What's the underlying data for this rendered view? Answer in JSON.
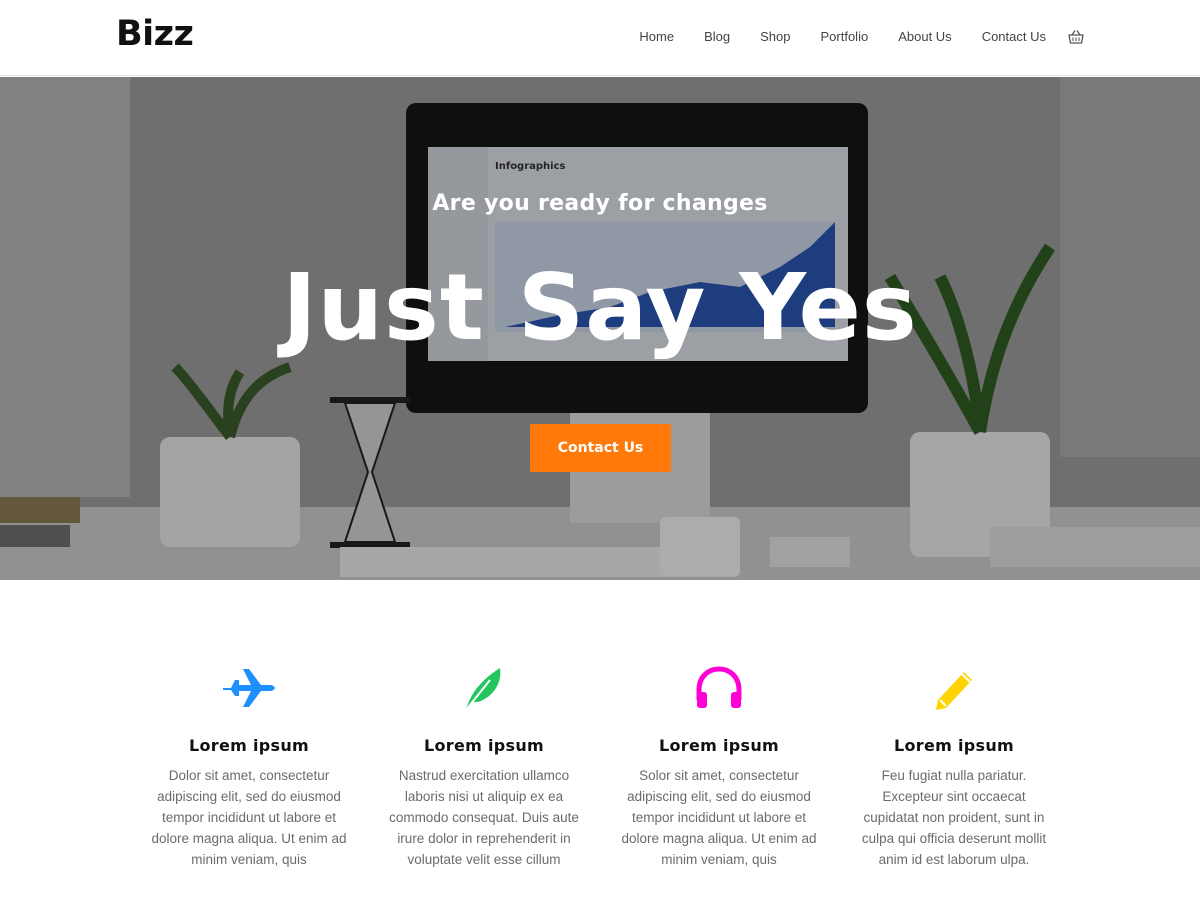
{
  "header": {
    "logo": "Bizz",
    "nav": [
      "Home",
      "Blog",
      "Shop",
      "Portfolio",
      "About Us",
      "Contact Us"
    ],
    "cart_icon": "shopping-basket-icon"
  },
  "hero": {
    "subtitle": "Are you ready for changes",
    "title": "Just Say Yes",
    "button_label": "Contact Us",
    "button_color": "#ff7a0a",
    "monitor_screen_title": "Infographics"
  },
  "features": [
    {
      "icon": "jet-plane-icon",
      "color": "#1e90ff",
      "title": "Lorem ipsum",
      "text": [
        "Dolor sit amet, consectetur",
        "adipiscing elit, sed do eiusmod",
        "tempor incididunt ut labore et",
        "dolore magna aliqua. Ut enim ad",
        "minim veniam, quis"
      ]
    },
    {
      "icon": "feather-icon",
      "color": "#22c55e",
      "title": "Lorem ipsum",
      "text": [
        "Nastrud exercitation ullamco",
        "laboris nisi ut aliquip ex ea",
        "commodo consequat. Duis aute",
        "irure dolor in reprehenderit in",
        "voluptate velit esse cillum"
      ]
    },
    {
      "icon": "headphones-icon",
      "color": "#ff00d4",
      "title": "Lorem ipsum",
      "text": [
        "Solor sit amet, consectetur",
        "adipiscing elit, sed do eiusmod",
        "tempor incididunt ut labore et",
        "dolore magna aliqua. Ut enim ad",
        "minim veniam, quis"
      ]
    },
    {
      "icon": "pencil-icon",
      "color": "#ffd400",
      "title": "Lorem ipsum",
      "text": [
        "Feu fugiat nulla pariatur.",
        "Excepteur sint occaecat",
        "cupidatat non proident, sunt in",
        "culpa qui officia deserunt mollit",
        "anim id est laborum ulpa."
      ]
    }
  ]
}
